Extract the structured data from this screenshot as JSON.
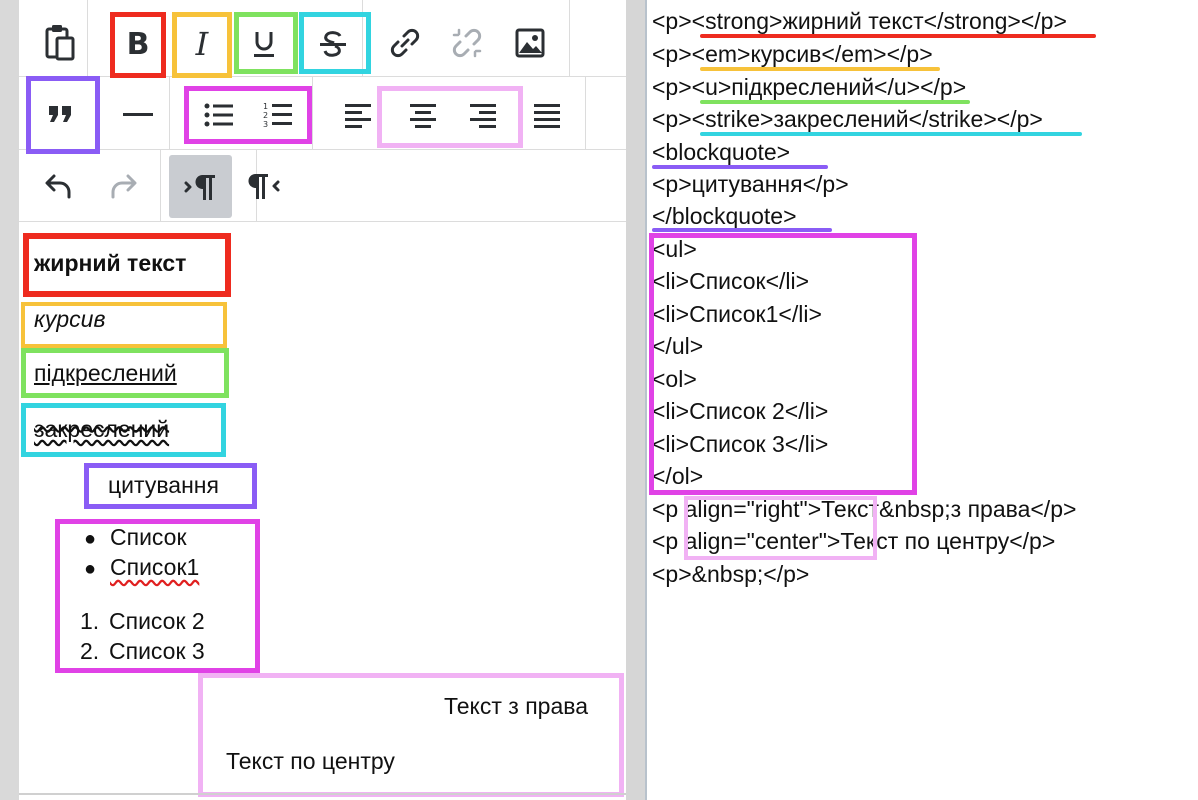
{
  "colors": {
    "bold": "#ee2b1f",
    "italic": "#f7c23a",
    "underline": "#7fe25f",
    "strike": "#32d4e0",
    "quote": "#8a5cf5",
    "lists": "#e042e6",
    "align": "#f1b2f4"
  },
  "toolbar": {
    "row1": [
      "clipboard-icon",
      "bold-icon",
      "italic-icon",
      "underline-icon",
      "strikethrough-icon",
      "link-icon",
      "unlink-icon",
      "image-icon"
    ],
    "row2": [
      "blockquote-icon",
      "horizontal-rule-icon",
      "bullet-list-icon",
      "numbered-list-icon",
      "align-left-icon",
      "align-center-icon",
      "align-right-icon",
      "align-justify-icon"
    ],
    "row3": [
      "undo-icon",
      "redo-icon",
      "ltr-paragraph-icon",
      "rtl-paragraph-icon"
    ],
    "bold_glyph": "B",
    "italic_glyph": "I"
  },
  "content": {
    "bold": "жирний текст",
    "italic": "курсив",
    "underline": "підкреслений",
    "strike": "закреслений",
    "quote": "цитування",
    "ul": [
      "Список",
      "Список1"
    ],
    "ol_markers": [
      "1.",
      "2."
    ],
    "ol": [
      "Список 2",
      "Список 3"
    ],
    "right": "Текст з права",
    "center": "Текст по центру"
  },
  "source": [
    "<p><strong>жирний текст</strong></p>",
    "<p><em>курсив</em></p>",
    "<p><u>підкреслений</u></p>",
    "<p><strike>закреслений</strike></p>",
    "<blockquote>",
    "<p>цитування</p>",
    "</blockquote>",
    "<ul>",
    "<li>Список</li>",
    "<li>Список1</li>",
    "</ul>",
    "<ol>",
    "<li>Список 2</li>",
    "<li>Список 3</li>",
    "</ol>",
    "<p align=\"right\">Текст&nbsp;з права</p>",
    "<p align=\"center\">Текст по центру</p>",
    "<p>&nbsp;</p>"
  ]
}
